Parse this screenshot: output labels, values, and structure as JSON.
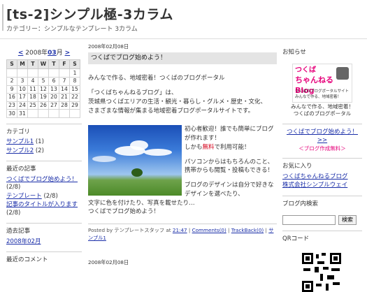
{
  "header": {
    "title": "[ts-2]シンプル極-3カラム",
    "description": "カテゴリー：シンプルなテンプレート 3カラム"
  },
  "calendar": {
    "prev": "<",
    "year_label": "2008年",
    "month": "03",
    "month_suffix": "月",
    "next": ">",
    "weekdays": [
      "S",
      "M",
      "T",
      "W",
      "T",
      "F",
      "S"
    ],
    "weeks": [
      [
        "",
        "",
        "",
        "",
        "",
        "",
        "1"
      ],
      [
        "2",
        "3",
        "4",
        "5",
        "6",
        "7",
        "8"
      ],
      [
        "9",
        "10",
        "11",
        "12",
        "13",
        "14",
        "15"
      ],
      [
        "16",
        "17",
        "18",
        "19",
        "20",
        "21",
        "22"
      ],
      [
        "23",
        "24",
        "25",
        "26",
        "27",
        "28",
        "29"
      ],
      [
        "30",
        "31",
        "",
        "",
        "",
        "",
        ""
      ]
    ]
  },
  "categories": {
    "heading": "カテゴリ",
    "items": [
      {
        "label": "サンプル1",
        "count": "(1)"
      },
      {
        "label": "サンプル2",
        "count": "(2)"
      }
    ]
  },
  "recent_posts": {
    "heading": "最近の記事",
    "items": [
      {
        "label": "つくばでブログ始めよう！",
        "count": "(2/8)"
      },
      {
        "label": "テンプレート",
        "count": "(2/8)"
      },
      {
        "label": "記事のタイトルが入ります",
        "count": "(2/8)"
      }
    ]
  },
  "archives": {
    "heading": "過去記事",
    "items": [
      {
        "label": "2008年02月"
      }
    ]
  },
  "recent_comments": {
    "heading": "最近のコメント"
  },
  "post": {
    "date": "2008年02月08日",
    "title": "つくばでブログ始めよう！",
    "p1": "みんなで作る、地域密着！つくばのブログポータル",
    "p2": "「つくばちゃんねるブログ」は、",
    "p3": "茨城県つくばエリアの生活・観光・暮らし・グルメ・歴史・文化、",
    "p4": "さまざまな情報が集まる地域密着ブログポータルサイトです。",
    "f1": "初心者歓迎！誰でも簡単にブログが作れます！",
    "f2a": "しかも",
    "f2red": "無料",
    "f2b": "で利用可能！",
    "f3": "パソコンからはもちろんのこと、携帯からも閲覧・投稿もできる！",
    "f4": "ブログのデザインは自分で好きなデザインを選べたり、",
    "f5": "文字に色を付けたり、写真を載せたり…",
    "f6": "つくばでブログ始めよう！",
    "meta_prefix": "Posted by テンプレートスタッフ at",
    "time": "21:47",
    "sep": "|",
    "comments": "Comments(0)",
    "trackback": "TrackBack(0)",
    "category": "サンプル1"
  },
  "post2": {
    "date": "2008年02月08日"
  },
  "notice": {
    "heading": "お知らせ",
    "banner_l1": "つくば",
    "banner_l2": "ちゃんねるBlog",
    "banner_l3": "つくばのブログポータルサイト",
    "banner_l4": "みんなで作る、地域密着！",
    "caption1": "みんなで作る、地域密着！",
    "caption2": "つくばのブログポータル",
    "link": "つくばでブログ始めよう！",
    "arrow": ">>",
    "free": "＜ブログ作成無料＞"
  },
  "favorites": {
    "heading": "お気に入り",
    "items": [
      {
        "label": "つくばちゃんねるブログ"
      },
      {
        "label": "株式会社シンプルウェイ"
      }
    ]
  },
  "search": {
    "heading": "ブログ内検索",
    "value": "",
    "button": "検索"
  },
  "qr": {
    "heading": "QRコード"
  },
  "colors": {
    "link": "#1a2ea8",
    "accent": "#e6007a",
    "red": "#d4001a",
    "title_bar": "#e4e4e4"
  }
}
